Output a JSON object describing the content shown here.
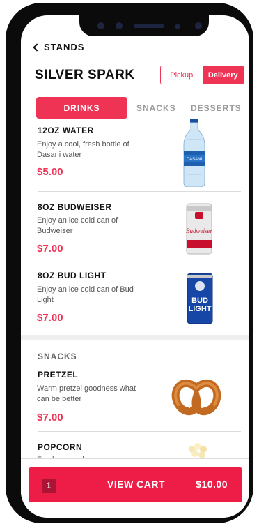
{
  "nav": {
    "back_label": "STANDS"
  },
  "header": {
    "title": "SILVER SPARK",
    "modes": {
      "pickup": "Pickup",
      "delivery": "Delivery",
      "selected": "Delivery"
    }
  },
  "tabs": [
    {
      "label": "DRINKS",
      "active": true
    },
    {
      "label": "SNACKS",
      "active": false
    },
    {
      "label": "DESSERTS",
      "active": false
    }
  ],
  "drinks": [
    {
      "name": "12OZ WATER",
      "description": "Enjoy a cool, fresh bottle of Dasani water",
      "price": "$5.00",
      "image": "dasani-water-bottle"
    },
    {
      "name": "8OZ BUDWEISER",
      "description": "Enjoy an ice cold can of Budweiser",
      "price": "$7.00",
      "image": "budweiser-can"
    },
    {
      "name": "8OZ BUD LIGHT",
      "description": "Enjoy an ice cold can of Bud Light",
      "price": "$7.00",
      "image": "bud-light-can"
    }
  ],
  "snacks_section": {
    "title": "SNACKS",
    "items": [
      {
        "name": "PRETZEL",
        "description": "Warm pretzel goodness what can be better",
        "price": "$7.00",
        "image": "pretzel"
      },
      {
        "name": "POPCORN",
        "description": "Fresh popped",
        "price": "",
        "image": "popcorn"
      }
    ]
  },
  "cart": {
    "count": "1",
    "label": "VIEW CART",
    "total": "$10.00"
  },
  "colors": {
    "accent": "#ee3354",
    "cart_button": "#ee1d48",
    "frame": "#0b0b0c"
  }
}
